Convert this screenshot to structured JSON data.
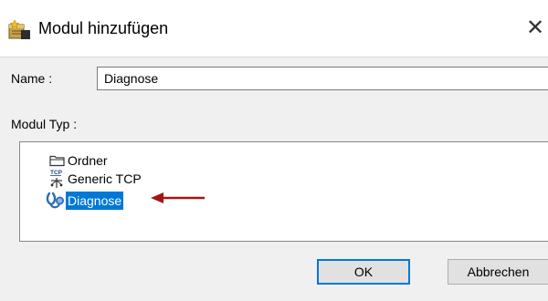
{
  "dialog": {
    "title": "Modul hinzufügen",
    "close_glyph": "✕"
  },
  "name_field": {
    "label": "Name :",
    "value": "Diagnose"
  },
  "module_type": {
    "label": "Modul Typ :",
    "items": [
      {
        "label": "Ordner",
        "icon": "folder-icon",
        "selected": false
      },
      {
        "label": "Generic TCP",
        "icon": "tcp-network-icon",
        "selected": false
      },
      {
        "label": "Diagnose",
        "icon": "stethoscope-icon",
        "selected": true
      }
    ]
  },
  "buttons": {
    "ok": "OK",
    "cancel": "Abbrechen"
  },
  "colors": {
    "selection": "#0078d7",
    "annotation_arrow": "#a31515"
  }
}
